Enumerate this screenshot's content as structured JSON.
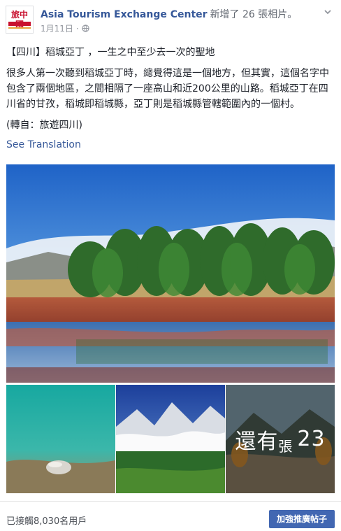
{
  "post": {
    "page_name": "Asia Tourism Exchange Center",
    "action_text": "新增了 26 張相片。",
    "date": "1月11日",
    "privacy_icon": "globe-icon",
    "menu_icon": "chevron-down-icon",
    "title_line": "【四川】稻城亞丁 ，一生之中至少去一次的聖地",
    "body_text": "很多人第一次聽到稻城亞丁時，總覺得這是一個地方，但其實，這個名字中包含了兩個地區，之間相隔了一座高山和近200公里的山路。稻城亞丁在四川省的甘孜，稻城即稻城縣，亞丁則是稻城縣管轄範圍內的一個村。",
    "source_note": "(轉自：旅遊四川)",
    "see_translation": "See Translation"
  },
  "photos": {
    "more_label_1": "還有",
    "more_label_2": "23",
    "more_label_3": "張"
  },
  "footer": {
    "reach_text": "已接觸8,030名用戶",
    "boost_button": "加強推廣帖子"
  },
  "colors": {
    "link": "#365899",
    "button": "#4267b2"
  }
}
